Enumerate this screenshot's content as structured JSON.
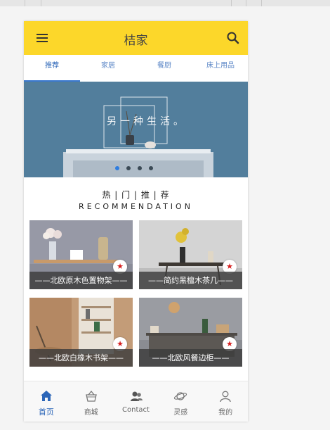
{
  "app": {
    "title": "桔家"
  },
  "tabs": [
    {
      "label": "推荐",
      "active": true
    },
    {
      "label": "家居",
      "active": false
    },
    {
      "label": "餐厨",
      "active": false
    },
    {
      "label": "床上用品",
      "active": false
    }
  ],
  "banner": {
    "slogan": "另一种生活。",
    "slide_count": 4,
    "active_slide": 1
  },
  "section": {
    "title_cn": "热 | 门 | 推 | 荐",
    "title_en": "RECOMMENDATION"
  },
  "products": [
    {
      "name": "——北欧原木色置物架——",
      "fav_icon": "star-icon"
    },
    {
      "name": "——简约黑檀木茶几——",
      "fav_icon": "star-icon"
    },
    {
      "name": "——北欧白橡木书架——",
      "fav_icon": "star-icon"
    },
    {
      "name": "——北欧风餐边柜——",
      "fav_icon": "star-icon"
    }
  ],
  "bottom_nav": [
    {
      "label": "首页",
      "icon": "home-icon",
      "active": true
    },
    {
      "label": "商城",
      "icon": "basket-icon",
      "active": false
    },
    {
      "label": "Contact",
      "icon": "contacts-icon",
      "active": false
    },
    {
      "label": "灵感",
      "icon": "planet-icon",
      "active": false
    },
    {
      "label": "我的",
      "icon": "user-icon",
      "active": false
    }
  ],
  "colors": {
    "appbar": "#fcd72a",
    "accent": "#2c66b8",
    "banner": "#4e7896",
    "fav_star": "#d62020"
  }
}
